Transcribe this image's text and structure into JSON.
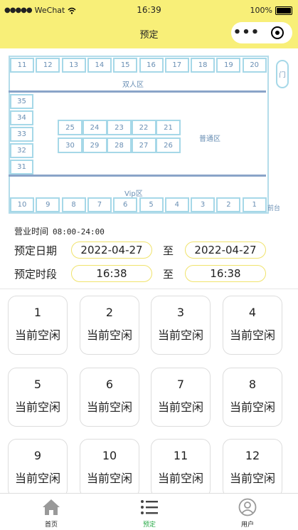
{
  "status_bar": {
    "signal": "●●●●●",
    "carrier": "WeChat",
    "time": "16:39",
    "battery": "100%",
    "battery_level": 1.0
  },
  "nav": {
    "title": "预定",
    "more_icon": "•••",
    "close_icon": "target-circle-icon"
  },
  "floor_plan": {
    "top_row": [
      "11",
      "12",
      "13",
      "14",
      "15",
      "16",
      "17",
      "18",
      "19",
      "20"
    ],
    "left_col": [
      "35",
      "34",
      "33",
      "32",
      "31"
    ],
    "middle_top": [
      "25",
      "24",
      "23",
      "22",
      "21"
    ],
    "middle_bottom": [
      "30",
      "29",
      "28",
      "27",
      "26"
    ],
    "bottom_row": [
      "10",
      "9",
      "8",
      "7",
      "6",
      "5",
      "4",
      "3",
      "2",
      "1"
    ],
    "zone_double": "双人区",
    "zone_normal": "普通区",
    "zone_vip": "Vip区",
    "door": "门",
    "counter": "前台"
  },
  "booking": {
    "hours_label": "营业时间",
    "hours_value": "08:00-24:00",
    "date_label": "预定日期",
    "date_start": "2022-04-27",
    "date_end": "2022-04-27",
    "time_label": "预定时段",
    "time_start": "16:38",
    "time_end": "16:38",
    "to": "至"
  },
  "seats": [
    {
      "num": "1",
      "status": "当前空闲"
    },
    {
      "num": "2",
      "status": "当前空闲"
    },
    {
      "num": "3",
      "status": "当前空闲"
    },
    {
      "num": "4",
      "status": "当前空闲"
    },
    {
      "num": "5",
      "status": "当前空闲"
    },
    {
      "num": "6",
      "status": "当前空闲"
    },
    {
      "num": "7",
      "status": "当前空闲"
    },
    {
      "num": "8",
      "status": "当前空闲"
    },
    {
      "num": "9",
      "status": "当前空闲"
    },
    {
      "num": "10",
      "status": "当前空闲"
    },
    {
      "num": "11",
      "status": "当前空闲"
    },
    {
      "num": "12",
      "status": "当前空闲"
    }
  ],
  "tabs": [
    {
      "label": "首页",
      "icon": "home-icon"
    },
    {
      "label": "预定",
      "icon": "list-icon"
    },
    {
      "label": "用户",
      "icon": "user-icon"
    }
  ],
  "colors": {
    "accent": "#f8ef78",
    "active_tab": "#2bab4a",
    "seat_border": "#a6d8e8",
    "divider": "#8aa4c8"
  }
}
